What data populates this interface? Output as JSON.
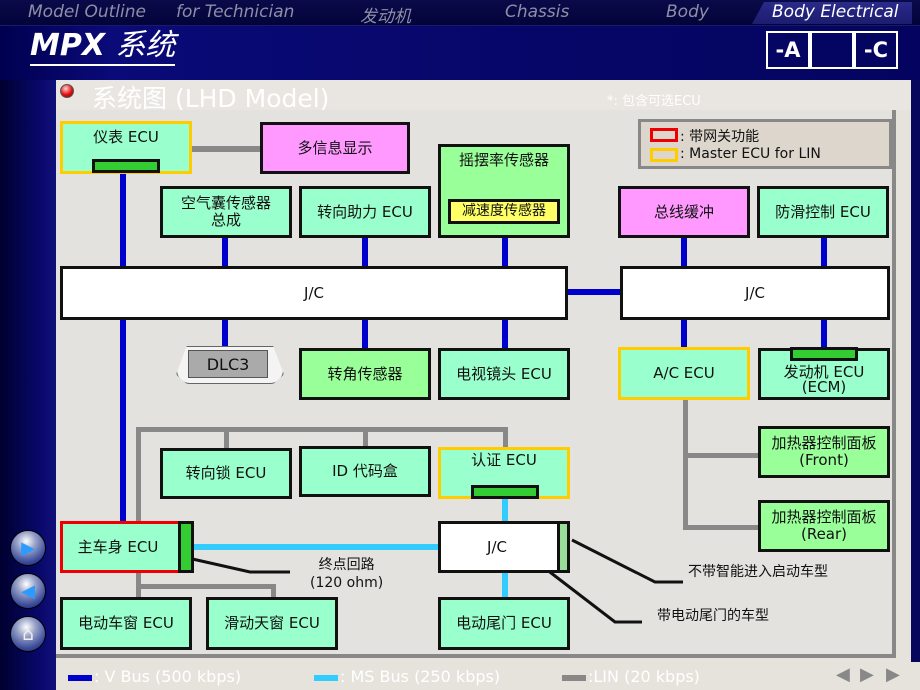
{
  "topnav": {
    "tabs": [
      {
        "label": "Model Outline",
        "active": false
      },
      {
        "label": "for Technician",
        "active": false
      },
      {
        "label": "发动机",
        "active": false
      },
      {
        "label": "Chassis",
        "active": false
      },
      {
        "label": "Body",
        "active": false
      },
      {
        "label": "Body Electrical",
        "active": true
      }
    ]
  },
  "header": {
    "title_en": "MPX",
    "title_cn": "系统",
    "page_buttons": [
      "-A",
      "",
      "-C"
    ]
  },
  "subheader": {
    "title": "系统图 (LHD Model)",
    "note": "*: 包含可选ECU"
  },
  "legend": {
    "items": [
      {
        "label": ": 带网关功能",
        "color": "#ee0000"
      },
      {
        "label": ": Master ECU for LIN",
        "color": "#ffcc00"
      }
    ]
  },
  "diagram": {
    "meter_ecu": "仪表 ECU",
    "multi_display": "多信息显示",
    "airbag": "空气囊传感器\n总成",
    "power_steering": "转向助力 ECU",
    "yaw_sensor": "摇摆率传感器",
    "decel_sensor": "减速度传感器",
    "bus_buffer": "总线缓冲",
    "skid_control": "防滑控制 ECU",
    "jc_left": "J/C",
    "jc_right": "J/C",
    "dlc3": "DLC3",
    "steering_angle": "转角传感器",
    "tv_camera": "电视镜头 ECU",
    "ac_ecu": "A/C ECU",
    "engine_ecu": "发动机 ECU\n(ECM)",
    "heater_front": "加热器控制面板\n(Front)",
    "heater_rear": "加热器控制面板\n(Rear)",
    "steering_lock": "转向锁 ECU",
    "id_code_box": "ID 代码盒",
    "cert_ecu": "认证 ECU",
    "main_body_ecu": "主车身 ECU",
    "jc_ms": "J/C",
    "termination": "终点回路\n(120 ohm)",
    "no_smart_entry": "不带智能进入启动车型",
    "power_back_door_note": "带电动尾门的车型",
    "power_window": "电动车窗 ECU",
    "sliding_roof": "滑动天窗 ECU",
    "back_door": "电动尾门 ECU"
  },
  "footer": {
    "buses": [
      {
        "label": ": V Bus (500 kbps)",
        "color": "#0000cc"
      },
      {
        "label": ": MS Bus (250 kbps)",
        "color": "#33ccff"
      },
      {
        "label": ":LIN (20 kbps)",
        "color": "#888888"
      }
    ]
  },
  "sidebar": {
    "buttons": [
      "next-icon",
      "back-icon",
      "home-icon"
    ]
  }
}
